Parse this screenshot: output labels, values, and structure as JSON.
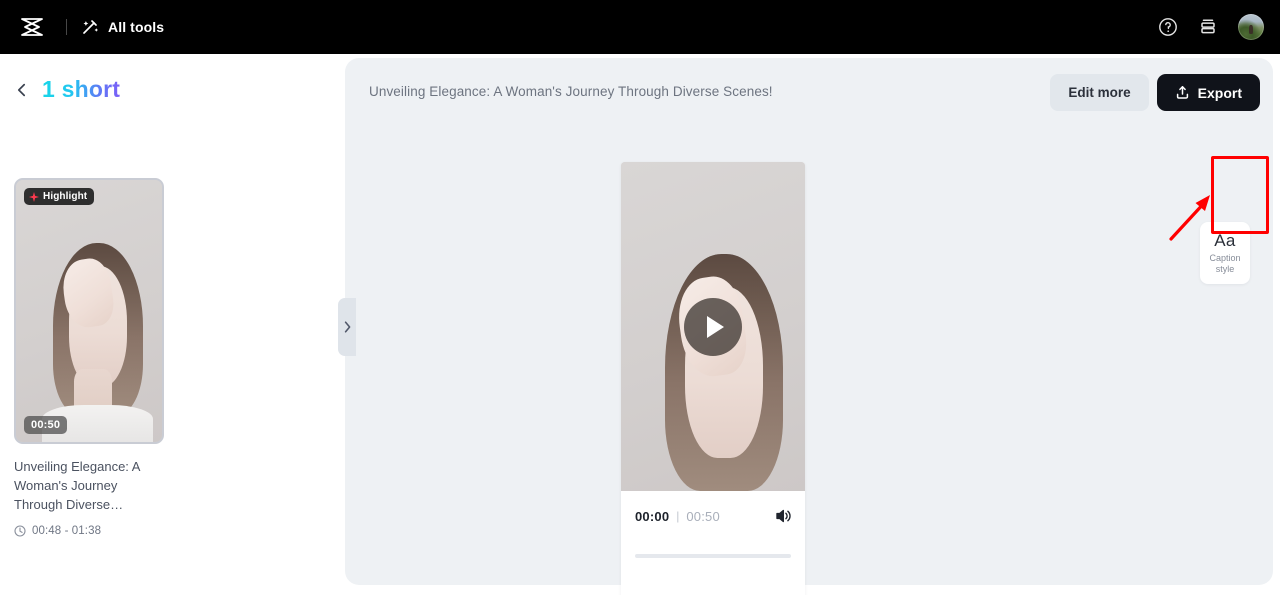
{
  "app": {
    "brand_name": "CapCut",
    "accent_gradient_from": "#18d6e8",
    "accent_gradient_to": "#7b5df7",
    "annotation_color": "#ff0000"
  },
  "topbar": {
    "logo_icon": "capcut-logo-icon",
    "all_tools_label": "All tools",
    "all_tools_icon": "magic-wand-icon",
    "help_icon": "help-circle-icon",
    "stack_icon": "layers-stack-icon",
    "avatar_icon": "user-avatar"
  },
  "sidebar": {
    "back_icon": "chevron-left-icon",
    "title": "1 short",
    "clip": {
      "highlight_badge": "Highlight",
      "highlight_icon": "sparkle-icon",
      "duration": "00:50",
      "title": "Unveiling Elegance: A Woman's Journey Through Diverse…",
      "range_icon": "clock-icon",
      "range": "00:48 - 01:38"
    }
  },
  "main": {
    "video_title": "Unveiling Elegance: A Woman's Journey Through Diverse Scenes!",
    "edit_more_label": "Edit more",
    "export_label": "Export",
    "export_icon": "upload-share-icon",
    "collapse_icon": "chevron-right-icon",
    "player": {
      "play_icon": "play-button-icon",
      "current_time": "00:00",
      "time_separator": "|",
      "total_time": "00:50",
      "volume_icon": "volume-on-icon"
    },
    "caption_style": {
      "icon_text": "Aa",
      "label_line1": "Caption",
      "label_line2": "style"
    },
    "annotation": {
      "arrow_icon": "red-arrow-icon",
      "box_icon": "red-highlight-box"
    }
  }
}
